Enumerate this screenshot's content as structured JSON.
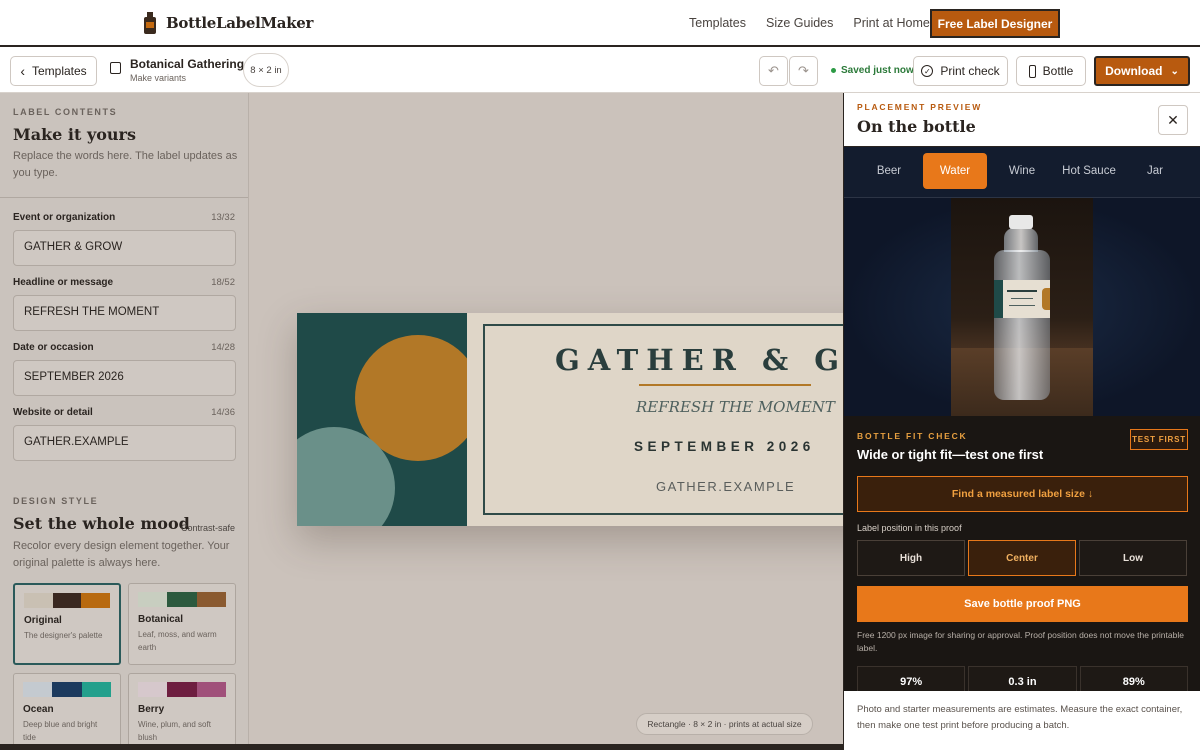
{
  "nav": {
    "brand": "BottleLabelMaker",
    "links": [
      "Templates",
      "Size Guides",
      "Print at Home"
    ],
    "cta": "Free Label Designer"
  },
  "toolbar": {
    "back_label": "Templates",
    "project_name": "Botanical Gathering",
    "project_sub": "Make variants",
    "size": "8 × 2 in",
    "saved": "Saved just now",
    "print_check": "Print check",
    "bottle": "Bottle",
    "download": "Download"
  },
  "contents": {
    "eyebrow": "LABEL CONTENTS",
    "title": "Make it yours",
    "desc": "Replace the words here. The label updates as you type.",
    "fields": [
      {
        "label": "Event or organization",
        "count": "13/32",
        "value": "GATHER & GROW"
      },
      {
        "label": "Headline or message",
        "count": "18/52",
        "value": "REFRESH THE MOMENT"
      },
      {
        "label": "Date or occasion",
        "count": "14/28",
        "value": "SEPTEMBER 2026"
      },
      {
        "label": "Website or detail",
        "count": "14/36",
        "value": "GATHER.EXAMPLE"
      }
    ]
  },
  "design": {
    "eyebrow": "DESIGN STYLE",
    "title": "Set the whole mood",
    "contrast": "Contrast-safe",
    "desc": "Recolor every design element together. Your original palette is always here.",
    "palettes": [
      {
        "name": "Original",
        "desc": "The designer's palette",
        "colors": [
          "#c9c0b3",
          "#3a2820",
          "#b86a10"
        ]
      },
      {
        "name": "Botanical",
        "desc": "Leaf, moss, and warm earth",
        "colors": [
          "#c8cec0",
          "#2c5a3e",
          "#8a5a30"
        ]
      },
      {
        "name": "Ocean",
        "desc": "Deep blue and bright tide",
        "colors": [
          "#c4cad0",
          "#1c3a5e",
          "#23a08c"
        ]
      },
      {
        "name": "Berry",
        "desc": "Wine, plum, and soft blush",
        "colors": [
          "#d6c8cc",
          "#6e1e40",
          "#a0507a"
        ]
      }
    ]
  },
  "label": {
    "title": "GATHER & GROW",
    "headline": "REFRESH THE MOMENT",
    "date": "SEPTEMBER 2026",
    "website": "GATHER.EXAMPLE",
    "colors": {
      "panel": "#1f4a48",
      "accent": "#b27827",
      "sage": "#6a9089",
      "paper": "#dfd6c8"
    }
  },
  "canvas_info": "Rectangle · 8 × 2 in · prints at actual size",
  "preview": {
    "eyebrow": "PLACEMENT PREVIEW",
    "title": "On the bottle",
    "tabs": [
      "Beer",
      "Water",
      "Wine",
      "Hot Sauce",
      "Jar"
    ],
    "active_tab": "Water"
  },
  "fit": {
    "eyebrow": "BOTTLE FIT CHECK",
    "title": "Wide or tight fit—test one first",
    "badge": "TEST FIRST",
    "find_button": "Find a measured label size ↓",
    "position_label": "Label position in this proof",
    "positions": [
      "High",
      "Center",
      "Low"
    ],
    "active_position": "Center",
    "save_button": "Save bottle proof PNG",
    "save_desc": "Free 1200 px image for sharing or approval. Proof position does not move the printable label.",
    "stats": [
      "97%",
      "0.3 in",
      "89%"
    ]
  },
  "disclaimer": "Photo and starter measurements are estimates. Measure the exact container, then make one test print before producing a batch.",
  "colors": {
    "accent": "#b85a0f",
    "accent_bright": "#e8781a",
    "dark": "#2a2420"
  }
}
